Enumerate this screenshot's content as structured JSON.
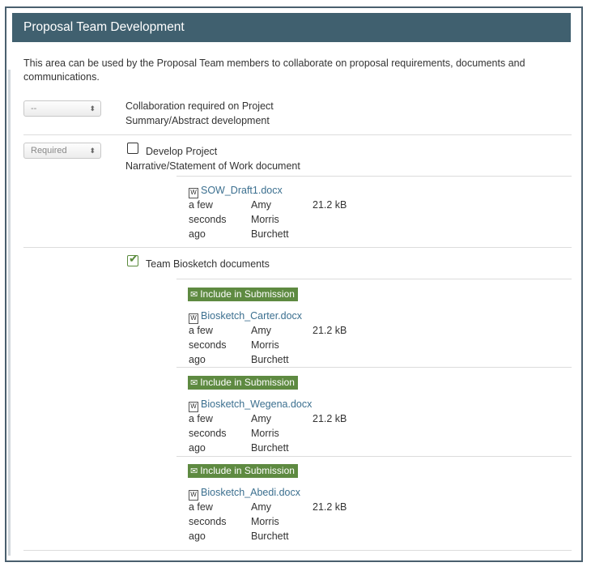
{
  "panel": {
    "title": "Proposal Team Development"
  },
  "intro": "This area can be used by the Proposal Team members to collaborate on proposal requirements, documents and communications.",
  "requirements": [
    {
      "select_value": "--",
      "line1": "Collaboration required on Project",
      "line2": "Summary/Abstract development"
    },
    {
      "select_value": "Required",
      "line1": "Develop Project",
      "line2": "Narrative/Statement of Work document",
      "checked": false
    },
    {
      "select_value": "",
      "line1": "Team Biosketch documents",
      "checked": true
    }
  ],
  "files": [
    {
      "name": "SOW_Draft1.docx",
      "when": [
        "a few",
        "seconds",
        "ago"
      ],
      "user": [
        "Amy",
        "Morris",
        "Burchett"
      ],
      "size": "21.2 kB"
    },
    {
      "badge": "Include in Submission",
      "name": "Biosketch_Carter.docx",
      "when": [
        "a few",
        "seconds",
        "ago"
      ],
      "user": [
        "Amy",
        "Morris",
        "Burchett"
      ],
      "size": "21.2 kB"
    },
    {
      "badge": "Include in Submission",
      "name": "Biosketch_Wegena.docx",
      "when": [
        "a few",
        "seconds",
        "ago"
      ],
      "user": [
        "Amy",
        "Morris",
        "Burchett"
      ],
      "size": "21.2 kB"
    },
    {
      "badge": "Include in Submission",
      "name": "Biosketch_Abedi.docx",
      "when": [
        "a few",
        "seconds",
        "ago"
      ],
      "user": [
        "Amy",
        "Morris",
        "Burchett"
      ],
      "size": "21.2 kB"
    }
  ],
  "icons": {
    "word_doc": "word-doc-icon",
    "envelope": "envelope-icon",
    "checkbox": "checkbox-icon"
  },
  "colors": {
    "header_bg": "#40606f",
    "badge_bg": "#5e8a41",
    "link": "#3b6f8f"
  }
}
